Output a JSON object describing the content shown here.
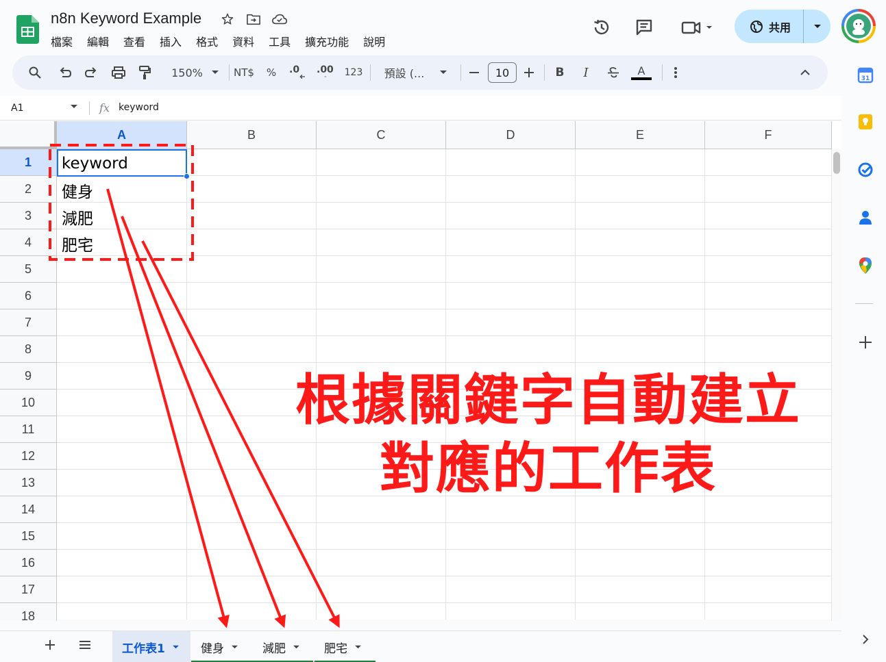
{
  "doc": {
    "title": "n8n Keyword Example",
    "menu": [
      "檔案",
      "編輯",
      "查看",
      "插入",
      "格式",
      "資料",
      "工具",
      "擴充功能",
      "說明"
    ]
  },
  "header": {
    "share_label": "共用",
    "icons": [
      "history-icon",
      "comment-icon",
      "meet-icon",
      "globe-icon",
      "avatar"
    ]
  },
  "toolbar": {
    "zoom": "150%",
    "currency": "NT$",
    "percent": "%",
    "decrease_decimal": ".0",
    "increase_decimal": ".00",
    "number_format": "123",
    "font_name": "預設 (...",
    "font_size": "10",
    "bold": "B",
    "italic": "I",
    "text_color": "A"
  },
  "formula_bar": {
    "cell_ref": "A1",
    "fx": "fx",
    "content": "keyword"
  },
  "grid": {
    "columns": [
      "A",
      "B",
      "C",
      "D",
      "E",
      "F"
    ],
    "rows": [
      "1",
      "2",
      "3",
      "4",
      "5",
      "6",
      "7",
      "8",
      "9",
      "10",
      "11",
      "12",
      "13",
      "14",
      "15",
      "16",
      "17",
      "18"
    ],
    "column_a_values": [
      "keyword",
      "健身",
      "減肥",
      "肥宅"
    ],
    "selected_cell": "A1"
  },
  "sheets": {
    "tabs": [
      "工作表1",
      "健身",
      "減肥",
      "肥宅"
    ],
    "active": "工作表1"
  },
  "annotation": {
    "line1": "根據關鍵字自動建立",
    "line2": "對應的工作表"
  },
  "colors": {
    "accent": "#0b57d0",
    "annotation": "#ff1a1a",
    "sheets_green": "#188038",
    "share_bg": "#c2e7ff"
  }
}
